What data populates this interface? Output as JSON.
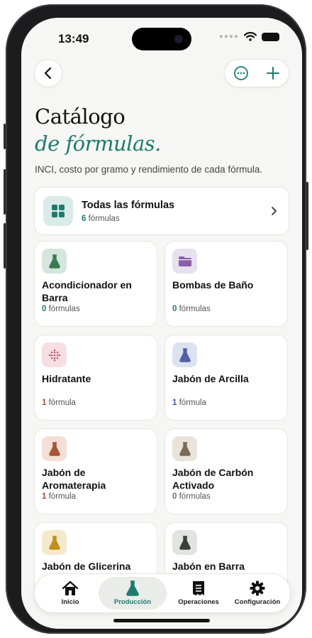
{
  "status_bar": {
    "time": "13:49"
  },
  "header": {
    "title_line1": "Catálogo",
    "title_line2": "de fórmulas.",
    "subtitle": "INCI, costo por gramo y rendimiento de cada fórmula."
  },
  "all_formulas": {
    "name": "Todas las fórmulas",
    "count": "6",
    "unit": "fórmulas"
  },
  "categories": [
    {
      "name": "Acondicionador en Barra",
      "count": "0",
      "unit": "fórmulas",
      "icon": "flask-icon",
      "icon_bg": "#d5e6dc",
      "icon_color": "#3c7a55",
      "count_color": "#1f7a6e"
    },
    {
      "name": "Bombas de Baño",
      "count": "0",
      "unit": "fórmulas",
      "icon": "folder-icon",
      "icon_bg": "#e7e0ee",
      "icon_color": "#8a5fa8",
      "count_color": "#1f7a6e"
    },
    {
      "name": "Hidratante",
      "count": "1",
      "unit": "fórmula",
      "icon": "dots-grid-icon",
      "icon_bg": "#f5dfe4",
      "icon_color": "#c45a72",
      "count_color": "#b4443f"
    },
    {
      "name": "Jabón de Arcilla",
      "count": "1",
      "unit": "fórmula",
      "icon": "flask-icon",
      "icon_bg": "#dde2f1",
      "icon_color": "#5062a3",
      "count_color": "#3a54a3"
    },
    {
      "name": "Jabón de Aromaterapia",
      "count": "1",
      "unit": "fórmula",
      "icon": "flask-icon",
      "icon_bg": "#f3dfd6",
      "icon_color": "#a8553a",
      "count_color": "#b4443f"
    },
    {
      "name": "Jabón de Carbón Activado",
      "count": "0",
      "unit": "fórmulas",
      "icon": "flask-icon",
      "icon_bg": "#e9e3da",
      "icon_color": "#7b6a55",
      "count_color": "#7b6a55"
    },
    {
      "name": "Jabón de Glicerina",
      "count": "",
      "unit": "",
      "icon": "flask-icon",
      "icon_bg": "#f5e9cc",
      "icon_color": "#c0901e",
      "count_color": "#c0901e"
    },
    {
      "name": "Jabón en Barra",
      "count": "",
      "unit": "",
      "icon": "flask-icon",
      "icon_bg": "#e2e4e2",
      "icon_color": "#384038",
      "count_color": "#384038"
    }
  ],
  "tabbar": {
    "tabs": [
      {
        "label": "Inicio",
        "icon": "home-icon",
        "active": false
      },
      {
        "label": "Producción",
        "icon": "flask-icon",
        "active": true
      },
      {
        "label": "Operaciones",
        "icon": "receipt-icon",
        "active": false
      },
      {
        "label": "Configuración",
        "icon": "gear-icon",
        "active": false
      }
    ]
  },
  "colors": {
    "accent": "#1f7a6e",
    "background": "#f6f7f5"
  }
}
